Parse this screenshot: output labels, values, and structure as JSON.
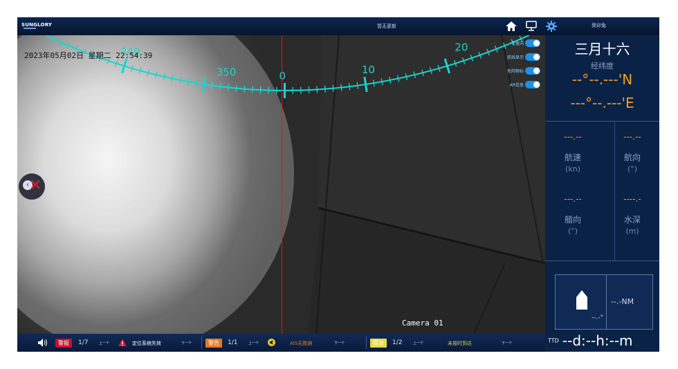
{
  "topbar": {
    "logo": "SUNGLORY",
    "status": "暂无更新",
    "icons": [
      "home-icon",
      "monitor-icon",
      "gear-icon"
    ]
  },
  "camera": {
    "datetime": "2023年05月02日  星期二  22:54:39",
    "label": "Camera 01",
    "heading_labels": [
      "340",
      "350",
      "0",
      "10",
      "20"
    ],
    "toggles": [
      {
        "label": "罗盘向",
        "on": true
      },
      {
        "label": "航线显示",
        "on": true
      },
      {
        "label": "危险物标",
        "on": true
      },
      {
        "label": "AR信息",
        "on": true
      }
    ]
  },
  "right_panel": {
    "ganzhi": "癸卯兔",
    "lunar_date": "三月十六",
    "coord_title": "经纬度",
    "lat_value": "--°--.---",
    "lat_unit": "'N",
    "lon_value": "---°--.---",
    "lon_unit": "'E",
    "speed": {
      "value": "---.--",
      "label": "航速",
      "unit": "(kn)"
    },
    "course": {
      "value": "---.--",
      "label": "航向",
      "unit": "(°)"
    },
    "heading": {
      "value": "---.--",
      "label": "艏向",
      "unit": "(°)"
    },
    "depth": {
      "value": "----.-",
      "label": "水深",
      "unit": "(m)"
    },
    "ship_angle": "--.-°",
    "distance": "--.-NM",
    "ttd_label": "TTD",
    "ttd_value": "--d:--h:--m"
  },
  "alarm_bar": {
    "alarm": {
      "tag": "警报",
      "count": "1/7",
      "prev": "上一个",
      "message": "定位系统失效",
      "next": "下一个",
      "color": "#c8102e"
    },
    "warning": {
      "tag": "警告",
      "count": "1/1",
      "prev": "上一个",
      "message": "AIS无数据",
      "next": "下一个",
      "color": "#e8781a"
    },
    "notice": {
      "tag": "提示",
      "count": "1/2",
      "prev": "上一个",
      "message": "未按时到达",
      "next": "下一个",
      "color": "#e8d94a"
    }
  }
}
